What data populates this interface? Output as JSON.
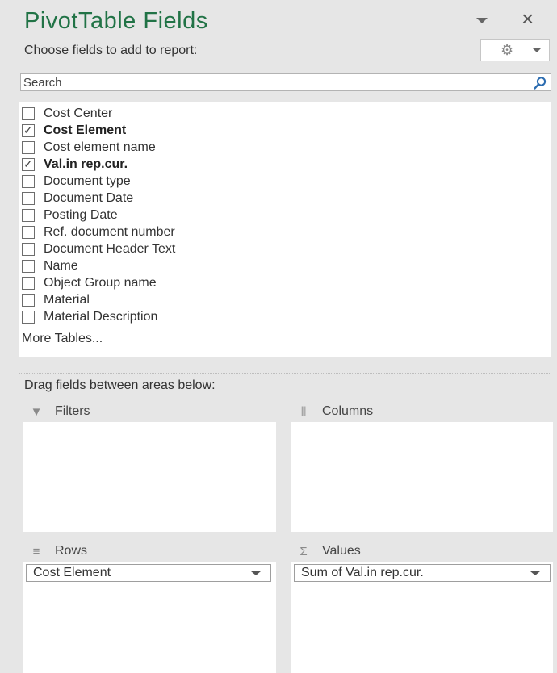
{
  "header": {
    "title": "PivotTable Fields",
    "menu_icon": "dropdown-arrow-icon",
    "close_icon": "×"
  },
  "chooser": {
    "label": "Choose fields to add to report:",
    "tools_icon": "gear-icon"
  },
  "search": {
    "placeholder": "Search",
    "value": ""
  },
  "fields": [
    {
      "label": "Cost Center",
      "checked": false
    },
    {
      "label": "Cost Element",
      "checked": true
    },
    {
      "label": "Cost element name",
      "checked": false
    },
    {
      "label": "Val.in rep.cur.",
      "checked": true
    },
    {
      "label": "Document type",
      "checked": false
    },
    {
      "label": "Document Date",
      "checked": false
    },
    {
      "label": "Posting Date",
      "checked": false
    },
    {
      "label": "Ref. document number",
      "checked": false
    },
    {
      "label": "Document Header Text",
      "checked": false
    },
    {
      "label": "Name",
      "checked": false
    },
    {
      "label": "Object Group name",
      "checked": false
    },
    {
      "label": "Material",
      "checked": false
    },
    {
      "label": "Material Description",
      "checked": false
    }
  ],
  "more_tables": "More Tables...",
  "areas": {
    "drag_label": "Drag fields between areas below:",
    "filters": {
      "label": "Filters",
      "icon": "filter-icon"
    },
    "columns": {
      "label": "Columns",
      "icon": "columns-icon"
    },
    "rows": {
      "label": "Rows",
      "icon": "rows-icon",
      "items": [
        "Cost Element"
      ]
    },
    "values": {
      "label": "Values",
      "icon": "sigma-icon",
      "items": [
        "Sum of Val.in rep.cur."
      ]
    }
  },
  "colors": {
    "title": "#217346",
    "pane_background": "#e6e6e6"
  }
}
